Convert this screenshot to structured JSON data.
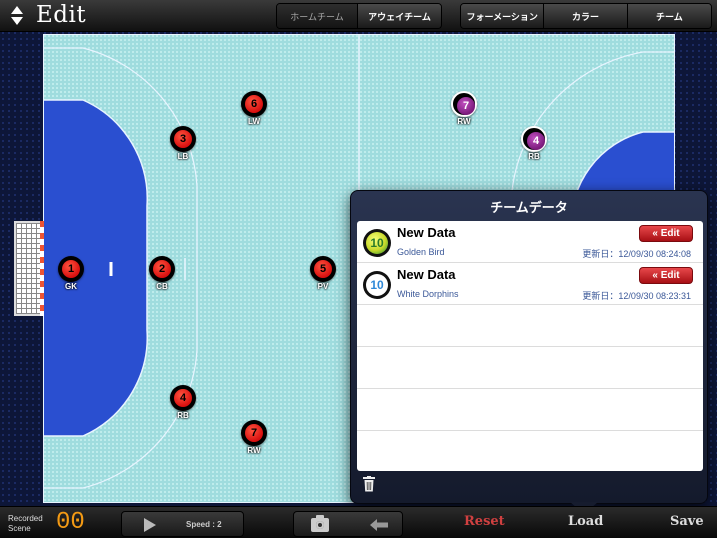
{
  "header": {
    "title": "Edit",
    "team_tabs": [
      "ホームチーム",
      "アウェイチーム"
    ],
    "tools": [
      "フォーメーション",
      "カラー",
      "チーム"
    ]
  },
  "court": {
    "home_players": [
      {
        "number": "1",
        "position": "GK"
      },
      {
        "number": "2",
        "position": "CB"
      },
      {
        "number": "3",
        "position": "LB"
      },
      {
        "number": "4",
        "position": "RB"
      },
      {
        "number": "5",
        "position": "PV"
      },
      {
        "number": "6",
        "position": "LW"
      },
      {
        "number": "7",
        "position": "RW"
      }
    ],
    "away_players": [
      {
        "number": "7",
        "position": "RW"
      },
      {
        "number": "4",
        "position": "RB"
      }
    ]
  },
  "team_data": {
    "title": "チームデータ",
    "rows": [
      {
        "name": "New Data",
        "team": "Golden Bird",
        "updated": "更新日：12/09/30 08:24:08",
        "badge": "10",
        "edit_label": "« Edit"
      },
      {
        "name": "New Data",
        "team": "White Dorphins",
        "updated": "更新日：12/09/30 08:23:31",
        "badge": "10",
        "edit_label": "« Edit"
      }
    ]
  },
  "footer": {
    "recorded_label": "Recorded Scene",
    "recorded_count": "00",
    "speed": "Speed : 2",
    "reset": "Reset",
    "load": "Load",
    "save": "Save"
  },
  "colors": {
    "court": "#9fdcde",
    "goal_area": "#2a4fd0",
    "home_player": "#d80f0f",
    "away_player": "#7a1a7a",
    "edit_button": "#c8161c",
    "reset": "#d04040",
    "recorded_count": "#f39a14"
  }
}
